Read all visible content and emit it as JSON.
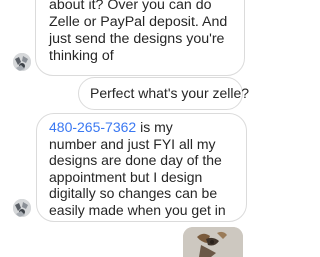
{
  "messages": [
    {
      "direction": "incoming",
      "text": "about it? Over you can do\nZelle or PayPal deposit. And\njust send the designs you're\nthinking of"
    },
    {
      "direction": "outgoing",
      "text": "Perfect what's your zelle?"
    },
    {
      "direction": "incoming",
      "phone": "480-265-7362",
      "text": " is my\nnumber and just FYI all my\ndesigns are done day of the\nappointment but I design\ndigitally so changes can be\neasily made when you get in"
    },
    {
      "direction": "outgoing",
      "type": "photo"
    }
  ],
  "colors": {
    "link": "#3a78f2",
    "bubble_border": "#dbdbdb",
    "text": "#262626",
    "background": "#ffffff"
  }
}
